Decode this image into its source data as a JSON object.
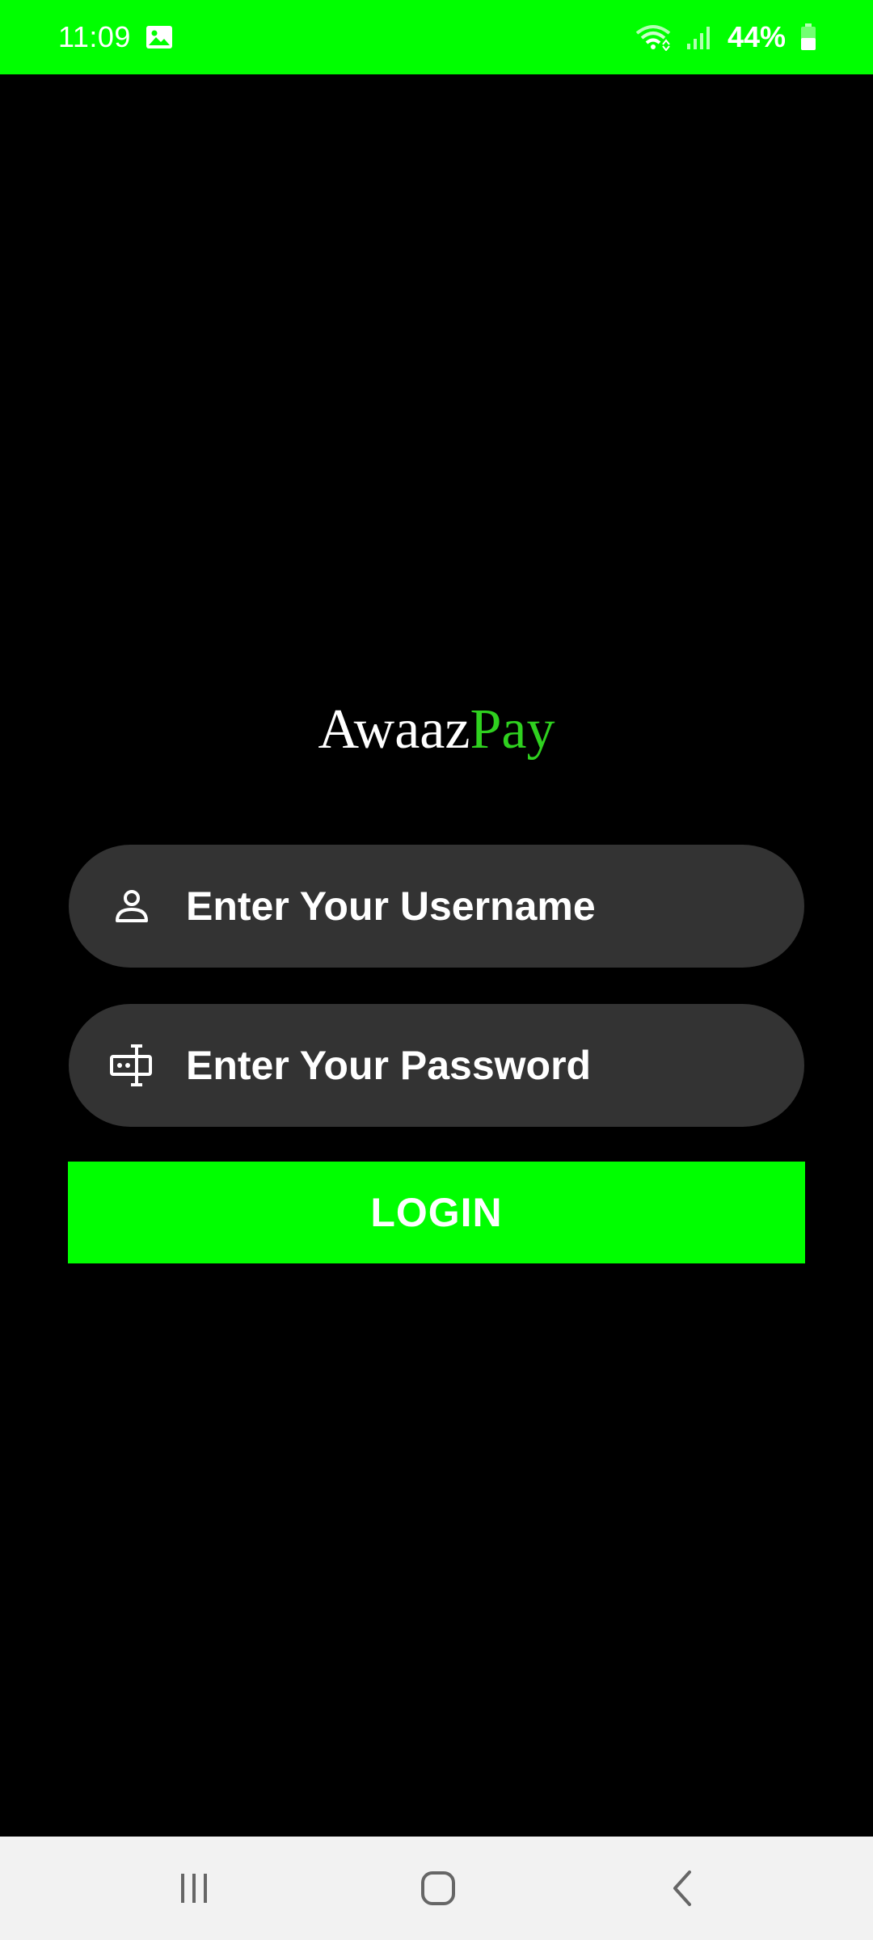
{
  "status_bar": {
    "time": "11:09",
    "battery_percent": "44%",
    "icons": [
      "gallery-icon",
      "wifi-icon",
      "signal-icon",
      "battery-icon"
    ],
    "background_color": "#00ff00"
  },
  "brand": {
    "part1": "Awaaz",
    "part2": "Pay",
    "part1_color": "#ffffff",
    "part2_color": "#2fd11f"
  },
  "login_form": {
    "username": {
      "placeholder": "Enter Your Username",
      "value": "",
      "icon": "person-icon"
    },
    "password": {
      "placeholder": "Enter Your Password",
      "value": "",
      "icon": "password-icon"
    },
    "login_button_label": "LOGIN",
    "button_color": "#00ff00",
    "field_color": "#333333"
  },
  "nav_bar": {
    "icons": [
      "recents-icon",
      "home-icon",
      "back-icon"
    ]
  }
}
